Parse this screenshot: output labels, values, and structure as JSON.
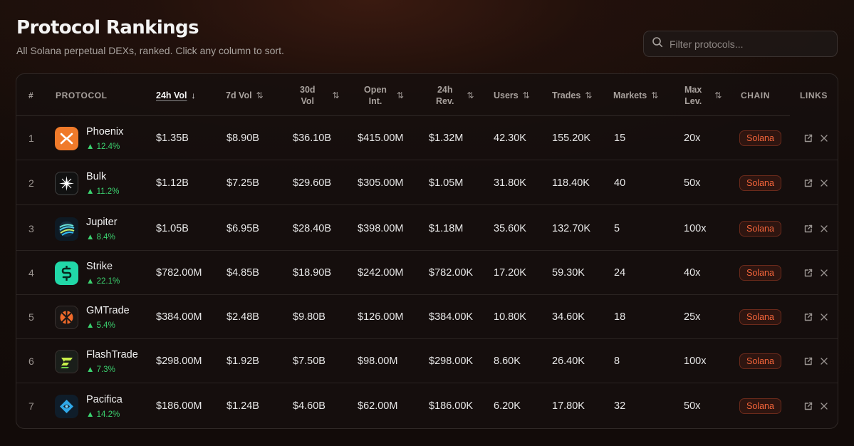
{
  "header": {
    "title": "Protocol Rankings",
    "subtitle": "All Solana perpetual DEXs, ranked. Click any column to sort."
  },
  "search": {
    "placeholder": "Filter protocols...",
    "icon": "search-icon"
  },
  "columns": {
    "rank": "#",
    "protocol": "PROTOCOL",
    "vol24": "24h Vol",
    "vol7": "7d Vol",
    "vol30": "30d\nVol",
    "oi": "Open\nInt.",
    "rev24": "24h\nRev.",
    "users": "Users",
    "trades": "Trades",
    "markets": "Markets",
    "maxlev": "Max\nLev.",
    "chain": "CHAIN",
    "links": "LINKS"
  },
  "sort": {
    "column": "vol24",
    "direction": "desc"
  },
  "rows": [
    {
      "rank": "1",
      "name": "Phoenix",
      "change": "▲ 12.4%",
      "vol24": "$1.35B",
      "vol7": "$8.90B",
      "vol30": "$36.10B",
      "oi": "$415.00M",
      "rev24": "$1.32M",
      "users": "42.30K",
      "trades": "155.20K",
      "markets": "15",
      "maxlev": "20x",
      "chain": "Solana",
      "logo": "phoenix-logo"
    },
    {
      "rank": "2",
      "name": "Bulk",
      "change": "▲ 11.2%",
      "vol24": "$1.12B",
      "vol7": "$7.25B",
      "vol30": "$29.60B",
      "oi": "$305.00M",
      "rev24": "$1.05M",
      "users": "31.80K",
      "trades": "118.40K",
      "markets": "40",
      "maxlev": "50x",
      "chain": "Solana",
      "logo": "bulk-logo"
    },
    {
      "rank": "3",
      "name": "Jupiter",
      "change": "▲ 8.4%",
      "vol24": "$1.05B",
      "vol7": "$6.95B",
      "vol30": "$28.40B",
      "oi": "$398.00M",
      "rev24": "$1.18M",
      "users": "35.60K",
      "trades": "132.70K",
      "markets": "5",
      "maxlev": "100x",
      "chain": "Solana",
      "logo": "jupiter-logo"
    },
    {
      "rank": "4",
      "name": "Strike",
      "change": "▲ 22.1%",
      "vol24": "$782.00M",
      "vol7": "$4.85B",
      "vol30": "$18.90B",
      "oi": "$242.00M",
      "rev24": "$782.00K",
      "users": "17.20K",
      "trades": "59.30K",
      "markets": "24",
      "maxlev": "40x",
      "chain": "Solana",
      "logo": "strike-logo"
    },
    {
      "rank": "5",
      "name": "GMTrade",
      "change": "▲ 5.4%",
      "vol24": "$384.00M",
      "vol7": "$2.48B",
      "vol30": "$9.80B",
      "oi": "$126.00M",
      "rev24": "$384.00K",
      "users": "10.80K",
      "trades": "34.60K",
      "markets": "18",
      "maxlev": "25x",
      "chain": "Solana",
      "logo": "gmtrade-logo"
    },
    {
      "rank": "6",
      "name": "FlashTrade",
      "change": "▲ 7.3%",
      "vol24": "$298.00M",
      "vol7": "$1.92B",
      "vol30": "$7.50B",
      "oi": "$98.00M",
      "rev24": "$298.00K",
      "users": "8.60K",
      "trades": "26.40K",
      "markets": "8",
      "maxlev": "100x",
      "chain": "Solana",
      "logo": "flashtrade-logo"
    },
    {
      "rank": "7",
      "name": "Pacifica",
      "change": "▲ 14.2%",
      "vol24": "$186.00M",
      "vol7": "$1.24B",
      "vol30": "$4.60B",
      "oi": "$62.00M",
      "rev24": "$186.00K",
      "users": "6.20K",
      "trades": "17.80K",
      "markets": "32",
      "maxlev": "50x",
      "chain": "Solana",
      "logo": "pacifica-logo"
    }
  ],
  "colors": {
    "positive": "#3BD16F",
    "chain_badge_text": "#F2643A",
    "chain_badge_bg": "#2E1510",
    "background": "#140C09"
  }
}
